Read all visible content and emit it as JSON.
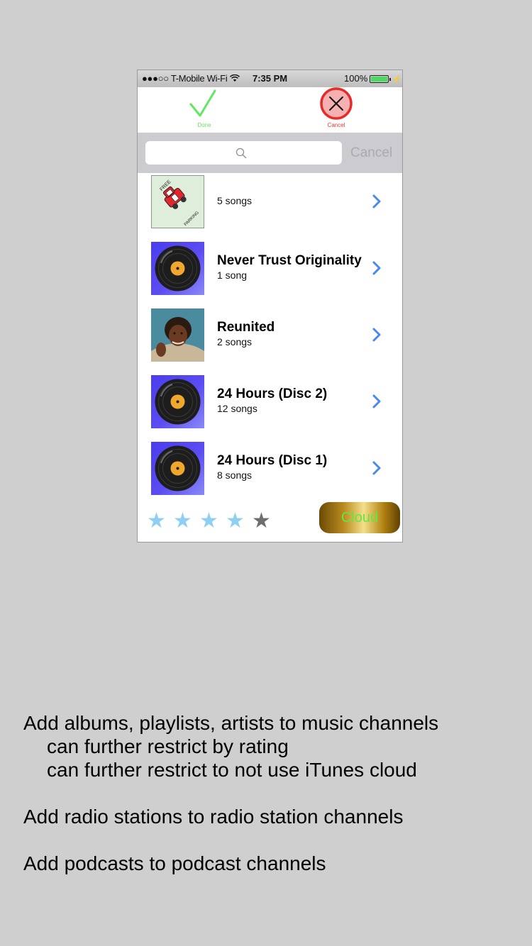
{
  "status_bar": {
    "carrier": "●●●○○ T-Mobile Wi-Fi",
    "wifi_icon": "wifi-icon",
    "time": "7:35 PM",
    "battery": "100%",
    "battery_level": 1.0
  },
  "toolbar": {
    "done_label": "Done",
    "cancel_label": "Cancel",
    "done_color": "#5fe85f",
    "cancel_color": "#e33c3c"
  },
  "search": {
    "placeholder": "",
    "cancel_label": "Cancel"
  },
  "albums": [
    {
      "title": "",
      "subtitle": "5 songs",
      "art": "free-parking-art"
    },
    {
      "title": "Never Trust Originality",
      "subtitle": "1 song",
      "art": "vinyl-record-art"
    },
    {
      "title": "Reunited",
      "subtitle": "2 songs",
      "art": "photo-art"
    },
    {
      "title": "24 Hours (Disc 2)",
      "subtitle": "12 songs",
      "art": "vinyl-record-art"
    },
    {
      "title": "24 Hours (Disc 1)",
      "subtitle": "8 songs",
      "art": "vinyl-record-art"
    }
  ],
  "footer": {
    "rating": 4,
    "rating_max": 5,
    "star_on_color": "#8fd0f2",
    "star_off_color": "#6e6e6e",
    "cloud_label": "Cloud"
  },
  "notes": {
    "line1": "Add albums, playlists, artists to music channels",
    "line2": "can further restrict by rating",
    "line3": "can further restrict to not use iTunes cloud",
    "line4": "Add radio stations to radio station channels",
    "line5": "Add podcasts to podcast channels"
  }
}
